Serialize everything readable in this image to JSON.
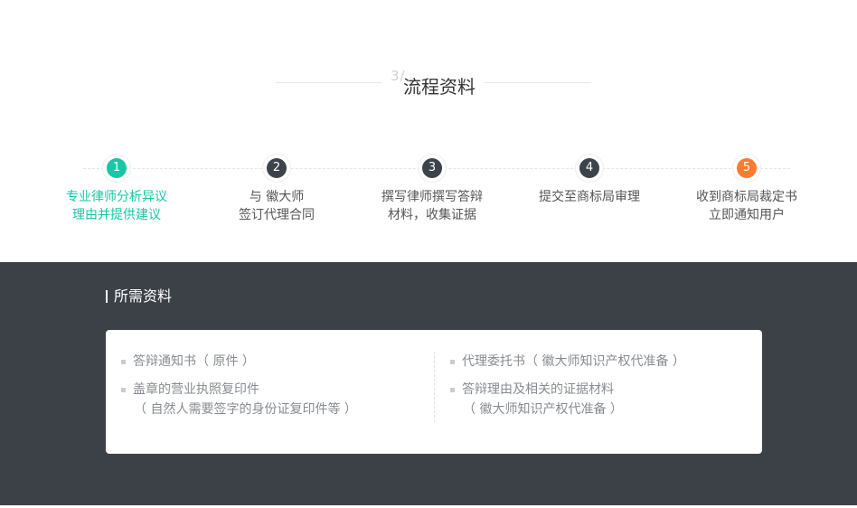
{
  "header": {
    "ghost": "3/",
    "title": "流程资料"
  },
  "steps": [
    {
      "number": "1",
      "line1": "专业律师分析异议",
      "line2": "理由并提供建议",
      "state": "active"
    },
    {
      "number": "2",
      "line1": "与 徽大师",
      "line2": "签订代理合同",
      "state": "normal"
    },
    {
      "number": "3",
      "line1": "撰写律师撰写答辩",
      "line2": "材料，收集证据",
      "state": "normal"
    },
    {
      "number": "4",
      "line1": "提交至商标局审理",
      "line2": "",
      "state": "normal"
    },
    {
      "number": "5",
      "line1": "收到商标局裁定书",
      "line2": "立即通知用户",
      "state": "final"
    }
  ],
  "materials": {
    "title": "所需资料",
    "left": [
      {
        "text": "答辩通知书（ 原件 ）",
        "sub": ""
      },
      {
        "text": "盖章的营业执照复印件",
        "sub": "（ 自然人需要签字的身份证复印件等 ）"
      }
    ],
    "right": [
      {
        "text": "代理委托书（ 徽大师知识产权代准备 ）",
        "sub": ""
      },
      {
        "text": "答辩理由及相关的证据材料",
        "sub": "（ 徽大师知识产权代准备 ）"
      }
    ]
  },
  "colors": {
    "accent": "#19c6a7",
    "final_step": "#ff7a2f",
    "step_dark": "#3d434b",
    "band_bg": "#3c4148"
  }
}
